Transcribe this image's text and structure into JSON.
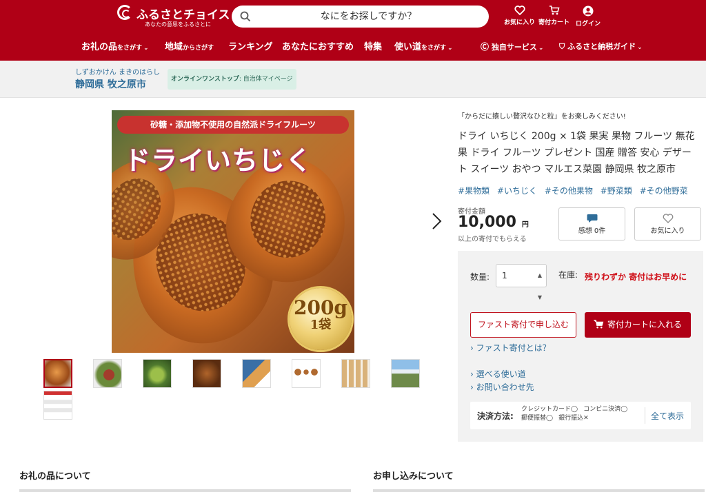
{
  "header": {
    "logo_title": "ふるさとチョイス",
    "logo_sub": "あなたの意思をふるさとに",
    "search_placeholder": "なにをお探しですか？",
    "favorites": "お気に入り",
    "cart": "寄付カート",
    "login": "ログイン"
  },
  "nav": [
    {
      "main": "お礼の品",
      "sub": "をさがす",
      "chev": true
    },
    {
      "main": "地域",
      "sub": "からさがす",
      "chev": false
    },
    {
      "main": "ランキング",
      "sub": "",
      "chev": false
    },
    {
      "main": "あなたにおすすめ",
      "sub": "",
      "chev": false
    },
    {
      "main": "特集",
      "sub": "",
      "chev": false
    },
    {
      "main": "使い道",
      "sub": "をさがす",
      "chev": true
    },
    {
      "main": "独自サービス",
      "sub": "",
      "chev": true
    },
    {
      "main": "ふるさと納税ガイド",
      "sub": "",
      "chev": true
    }
  ],
  "municipality": {
    "kana": "しずおかけん まきのはらし",
    "name": "静岡県 牧之原市",
    "onestop_bold": "オンラインワンストップ",
    "onestop_rest": ": 自治体マイページ"
  },
  "image": {
    "banner": "砂糖・添加物不使用の自然派ドライフルーツ",
    "title": "ドライいちじく",
    "seal_weight": "200g",
    "seal_bags": "1袋"
  },
  "product": {
    "catch": "「からだに嬉しい贅沢なひと粒」をお楽しみください!",
    "title": "ドライ いちじく 200g × 1袋 果実 果物 フルーツ 無花果 ドライ フルーツ プレゼント 国産 贈答 安心 デザート スイーツ おやつ マルエス菜園 静岡県 牧之原市",
    "tags": [
      "#果物類",
      "#いちじく",
      "#その他果物",
      "#野菜類",
      "#その他野菜"
    ],
    "amount_label": "寄付金額",
    "amount": "10,000",
    "amount_unit": "円",
    "amount_note": "以上の寄付でもらえる",
    "impressions": "感想 0件",
    "favorite": "お気に入り"
  },
  "order": {
    "qty_label": "数量:",
    "qty_value": "1",
    "stock_label": "在庫:",
    "stock_value": "残りわずか 寄付はお早めに",
    "fast_button": "ファスト寄付で申し込む",
    "cart_button": "寄付カートに入れる",
    "fast_link": "› ファスト寄付とは？",
    "uses_link": "› 選べる使い道",
    "contact_link": "› お問い合わせ先",
    "payment_label": "決済方法:",
    "payment_methods": [
      "クレジットカード◯",
      "コンビニ決済◯",
      "郵便振替◯",
      "銀行振込✕"
    ],
    "payment_all": "全て表示"
  },
  "sections": {
    "about": "お礼の品について",
    "apply": "お申し込みについて"
  },
  "colors": {
    "brand": "#b00016",
    "link": "#2f6d99",
    "warning": "#d0121b"
  }
}
